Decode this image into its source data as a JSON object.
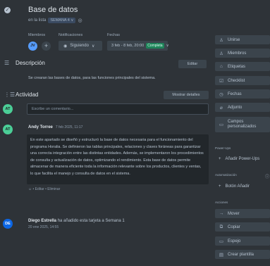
{
  "card": {
    "title": "Base de datos",
    "list_prefix": "en la lista",
    "list_name": "SEMANA 4 ∨"
  },
  "fields": {
    "members_label": "Miembros",
    "notifications_label": "Notificaciones",
    "dates_label": "Fechas",
    "member_initials": "JV",
    "notify_label": "Siguiendo",
    "date_range": "3 feb - 8 feb, 20:00",
    "status": "Completa"
  },
  "description": {
    "title": "Descripción",
    "edit_label": "Editar",
    "text": "Se crearan las bases de datos, para las funciones principales del sistema."
  },
  "activity": {
    "title": "Actividad",
    "show_details": "Mostrar detalles",
    "user_initials": "AT",
    "comment_placeholder": "Escribe un comentario...",
    "comment": {
      "initials": "AT",
      "author": "Andy Torree",
      "date": "7 feb 2025, 11:17",
      "body": "En este apartado se diseñó y estructuró la base de datos necesaria para el funcionamiento del programa Horalia. Se definieron las tablas principales, relaciones y claves foráneas para garantizar una correcta integración entre las distintas entidades. Además, se implementaron los procedimientos de consulta y actualización de datos, optimizando el rendimiento. Esta base de datos permite almacenar de manera eficiente toda la información relevante sobre los productos, clientes y ventas, lo que facilita el manejo y consulta de datos en el sistema.",
      "actions": "☺ • Editar • Eliminar"
    },
    "log": {
      "initials": "DE",
      "name": "Diego Estrella",
      "text": "ha añadido esta tarjeta a Semana 1",
      "date": "20 ene 2025, 14:55"
    }
  },
  "sidebar": {
    "join": "Unirse",
    "members": "Miembros",
    "labels": "Etiquetas",
    "checklist": "Checklist",
    "dates": "Fechas",
    "attachment": "Adjunto",
    "custom_fields_1": "Campos",
    "custom_fields_2": "personalizados",
    "powerups_label": "Power-Ups",
    "add_powerups": "Añadir Power-Ups",
    "automation_label": "Automatización",
    "add_button": "Botón Añadir",
    "actions_label": "Acciones",
    "move": "Mover",
    "copy": "Copiar",
    "mirror": "Espejo",
    "template": "Crear plantilla"
  },
  "colors": {
    "background": "#2e3338",
    "button": "#3b444c",
    "complete_green": "#1f845a",
    "at_avatar": "#4bce97",
    "de_avatar": "#0c66e4",
    "jv_avatar": "#579dff"
  }
}
